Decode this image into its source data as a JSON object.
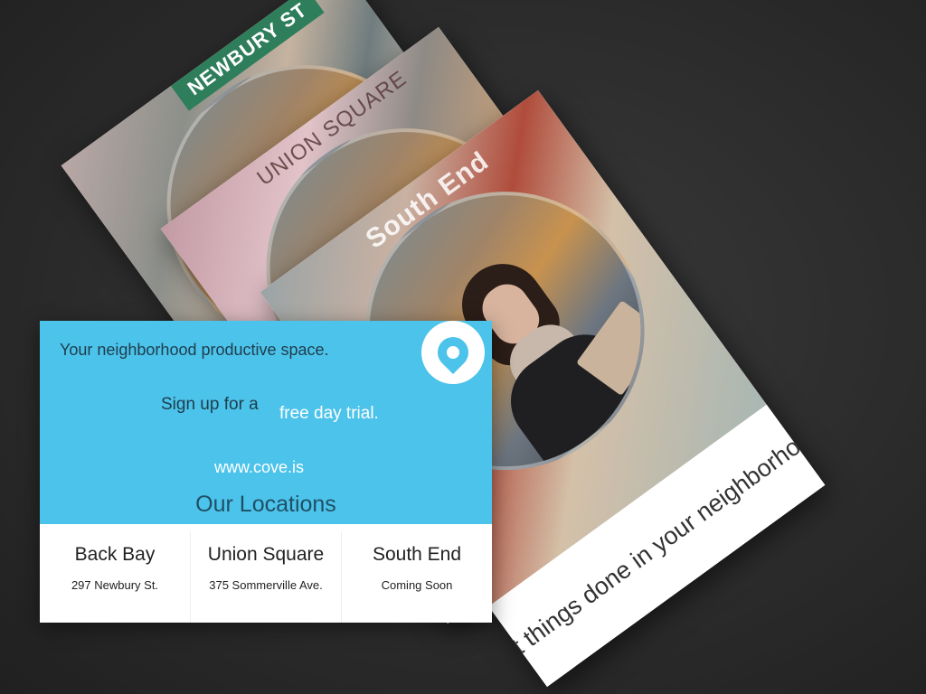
{
  "cards": {
    "newbury_sign": "NEWBURY ST",
    "union_square_sign": "UNION SQUARE",
    "south_end_sign": "South End",
    "tagline": "Get things done in your neighborhood."
  },
  "flyer": {
    "headline": "Your neighborhood productive space.",
    "signup_text": "Sign up for a",
    "signup_highlight": "free day trial.",
    "url": "www.cove.is",
    "locations_title": "Our Locations",
    "logo_icon": "location-pin-icon",
    "locations": [
      {
        "name": "Back Bay",
        "address": "297 Newbury St."
      },
      {
        "name": "Union Square",
        "address": "375 Sommerville Ave."
      },
      {
        "name": "South End",
        "address": "Coming Soon"
      }
    ]
  },
  "colors": {
    "flyer_blue": "#4cc3ea",
    "background": "#2c2c2c",
    "sign_green": "#2e7d5b"
  }
}
